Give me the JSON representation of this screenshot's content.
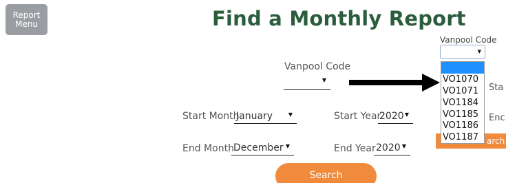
{
  "report_menu_label": "Report\nMenu",
  "page_title": "Find a Monthly Report",
  "form": {
    "vanpool_code_label": "Vanpool Code",
    "vanpool_code_value": "",
    "start_month_label": "Start Month",
    "start_month_value": "January",
    "start_year_label": "Start Year",
    "start_year_value": "2020",
    "end_month_label": "End Month",
    "end_month_value": "December",
    "end_year_label": "End Year",
    "end_year_value": "2020",
    "search_label": "Search"
  },
  "inset": {
    "title": "Vanpool Code",
    "options": [
      "",
      "VO1070",
      "VO1071",
      "VO1184",
      "VO1185",
      "VO1186",
      "VO1187"
    ],
    "partial_start": "Sta",
    "partial_end": "Enc",
    "partial_search": "arch"
  },
  "colors": {
    "title_green": "#2b5d3c",
    "search_orange": "#f08a3c",
    "menu_gray": "#9a9ea3",
    "highlight_blue": "#1e90ff"
  }
}
